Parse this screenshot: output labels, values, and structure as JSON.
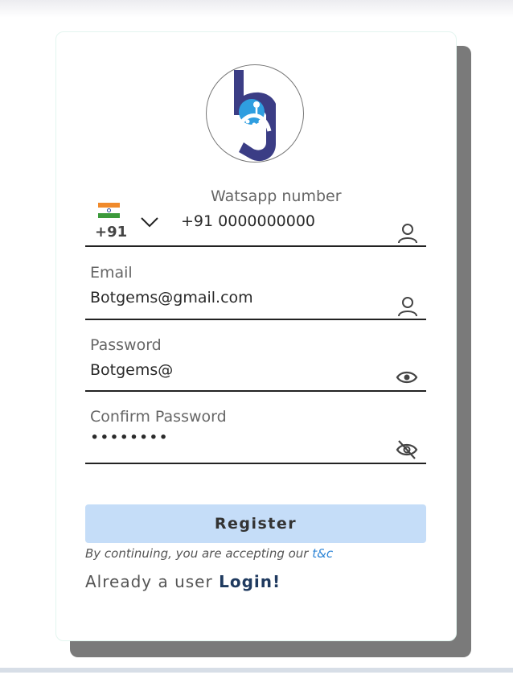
{
  "form": {
    "phone": {
      "label": "Watsapp number",
      "country_code": "+91",
      "country_flag": "india-flag",
      "value": "+91 0000000000"
    },
    "email": {
      "label": "Email",
      "value": "Botgems@gmail.com"
    },
    "password": {
      "label": "Password",
      "value": "Botgems@"
    },
    "confirm_password": {
      "label": "Confirm Password",
      "value": "••••••••"
    },
    "register_label": "Register",
    "terms_prefix": "By continuing, you are accepting our",
    "terms_link": "t&c",
    "login_prefix": "Already a user",
    "login_link": "Login!"
  },
  "icons": {
    "phone_field": "user-icon",
    "email_field": "user-icon",
    "password_field": "eye-icon",
    "confirm_password_field": "eye-off-icon",
    "country_dropdown": "chevron-down-icon"
  },
  "colors": {
    "button_bg": "#c5ddf8",
    "link_blue": "#2e85d6",
    "login_link": "#1f3a5f",
    "logo_navy": "#3b3d85",
    "logo_blue": "#2f9ee0",
    "card_shadow": "#7a7a7a"
  }
}
